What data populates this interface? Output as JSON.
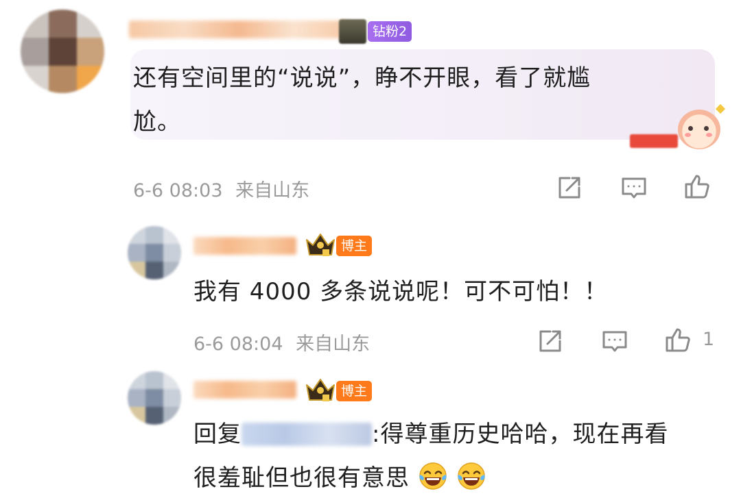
{
  "comment": {
    "badge": "钻粉2",
    "text": "还有空间里的“说说”，睁不开眼，看了就尴尬。",
    "line1": "还有空间里的“说说”，睁不开眼，看了就尴",
    "line2": "尬。",
    "date": "6-6 08:03",
    "location": "来自山东"
  },
  "reply1": {
    "badge": "博主",
    "text": "我有 4000 多条说说呢！可不可怕！！",
    "date": "6-6 08:04",
    "location": "来自山东",
    "like_count": "1"
  },
  "reply2": {
    "badge": "博主",
    "reply_prefix": "回复",
    "line1_rest": ":得尊重历史哈哈，现在再看",
    "line2": "很羞耻但也很有意思"
  },
  "icons": {
    "share": "share-icon",
    "comment": "comment-icon",
    "like": "thumbs-up-icon",
    "emoji": "laugh-tears-emoji"
  },
  "colors": {
    "badge_purple": "#9b5de5",
    "badge_orange": "#ff7a1a",
    "meta_gray": "#9a9a9a"
  }
}
